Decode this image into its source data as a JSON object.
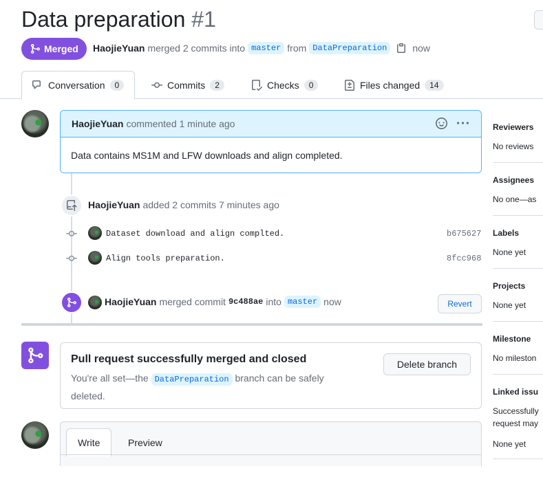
{
  "header": {
    "title": "Data preparation",
    "number": "#1",
    "state_label": "Merged",
    "author": "HaojieYuan",
    "merged_text": "merged 2 commits into",
    "base_branch": "master",
    "from_text": "from",
    "head_branch": "DataPreparation",
    "time": "now"
  },
  "tabs": [
    {
      "label": "Conversation",
      "count": "0"
    },
    {
      "label": "Commits",
      "count": "2"
    },
    {
      "label": "Checks",
      "count": "0"
    },
    {
      "label": "Files changed",
      "count": "14"
    }
  ],
  "comment": {
    "author": "HaojieYuan",
    "action": "commented 1 minute ago",
    "body": "Data contains MS1M and LFW downloads and align completed."
  },
  "commits_event": {
    "author": "HaojieYuan",
    "text": "added 2 commits 7 minutes ago",
    "commits": [
      {
        "message": "Dataset download and align complted.",
        "sha": "b675627"
      },
      {
        "message": "Align tools preparation.",
        "sha": "8fcc968"
      }
    ]
  },
  "merge_event": {
    "author": "HaojieYuan",
    "text": "merged commit",
    "sha": "9c488ae",
    "into": "into",
    "branch": "master",
    "time": "now",
    "revert_label": "Revert"
  },
  "merged_box": {
    "title": "Pull request successfully merged and closed",
    "desc_before": "You're all set—the",
    "branch": "DataPreparation",
    "desc_after": "branch can be safely deleted.",
    "delete_label": "Delete branch"
  },
  "editor": {
    "write_tab": "Write",
    "preview_tab": "Preview"
  },
  "sidebar": {
    "reviewers": {
      "heading": "Reviewers",
      "value": "No reviews"
    },
    "assignees": {
      "heading": "Assignees",
      "value": "No one—as"
    },
    "labels": {
      "heading": "Labels",
      "value": "None yet"
    },
    "projects": {
      "heading": "Projects",
      "value": "None yet"
    },
    "milestone": {
      "heading": "Milestone",
      "value": "No mileston"
    },
    "linked": {
      "heading": "Linked issu",
      "value_line1": "Successfully",
      "value_line2": "request may",
      "value_line3": "None yet"
    }
  }
}
